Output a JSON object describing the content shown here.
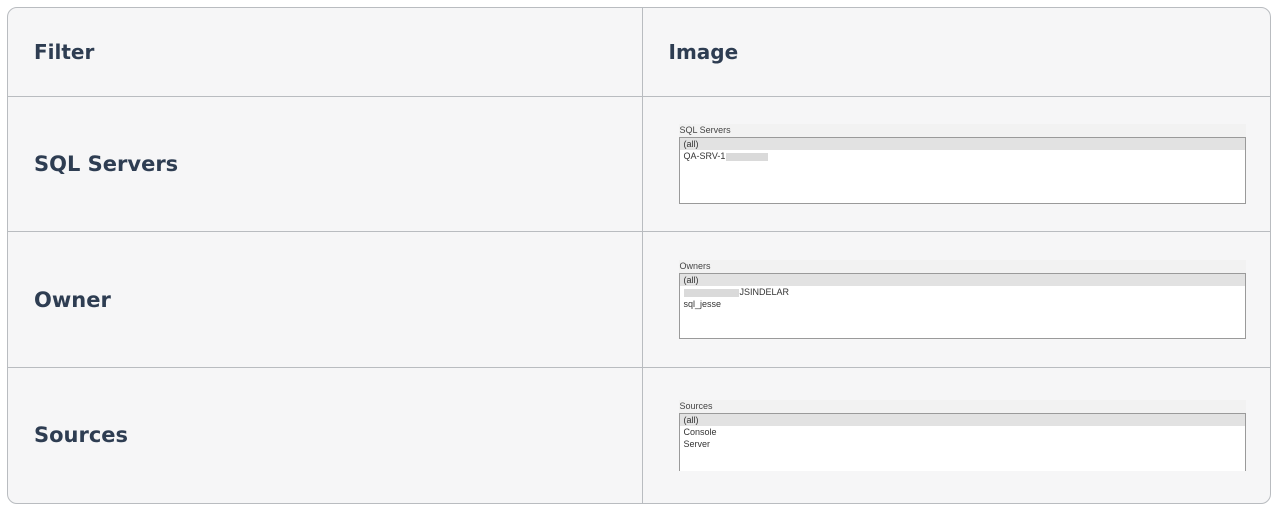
{
  "header": {
    "filter_label": "Filter",
    "image_label": "Image"
  },
  "rows": [
    {
      "filter": "SQL Servers",
      "widget_title": "SQL Servers",
      "items": [
        "(all)",
        "QA-SRV-1"
      ]
    },
    {
      "filter": "Owner",
      "widget_title": "Owners",
      "items": [
        "(all)",
        "JSINDELAR",
        "sql_jesse"
      ]
    },
    {
      "filter": "Sources",
      "widget_title": "Sources",
      "items": [
        "(all)",
        "Console",
        "Server"
      ]
    }
  ]
}
